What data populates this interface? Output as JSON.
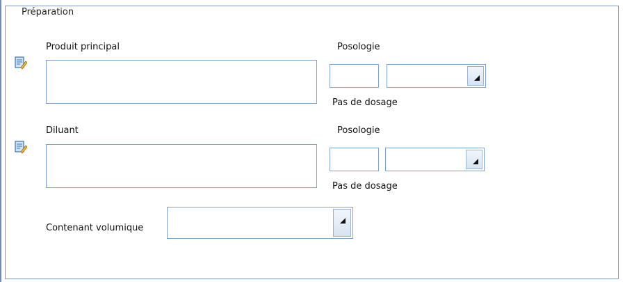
{
  "group": {
    "title": "Préparation"
  },
  "produit": {
    "label": "Produit principal",
    "value": "",
    "posologie_label": "Posologie",
    "posologie_value": "",
    "posologie_unit": "",
    "pas_label": "Pas de dosage"
  },
  "diluant": {
    "label": "Diluant",
    "value": "",
    "posologie_label": "Posologie",
    "posologie_value": "",
    "posologie_unit": "",
    "pas_label": "Pas de dosage"
  },
  "contenant": {
    "label": "Contenant volumique",
    "value": ""
  },
  "icons": {
    "produit_icon": "edit-icon",
    "diluant_icon": "edit-icon"
  },
  "colors": {
    "border": "#7da2ce",
    "frame": "#7a9cc4"
  }
}
